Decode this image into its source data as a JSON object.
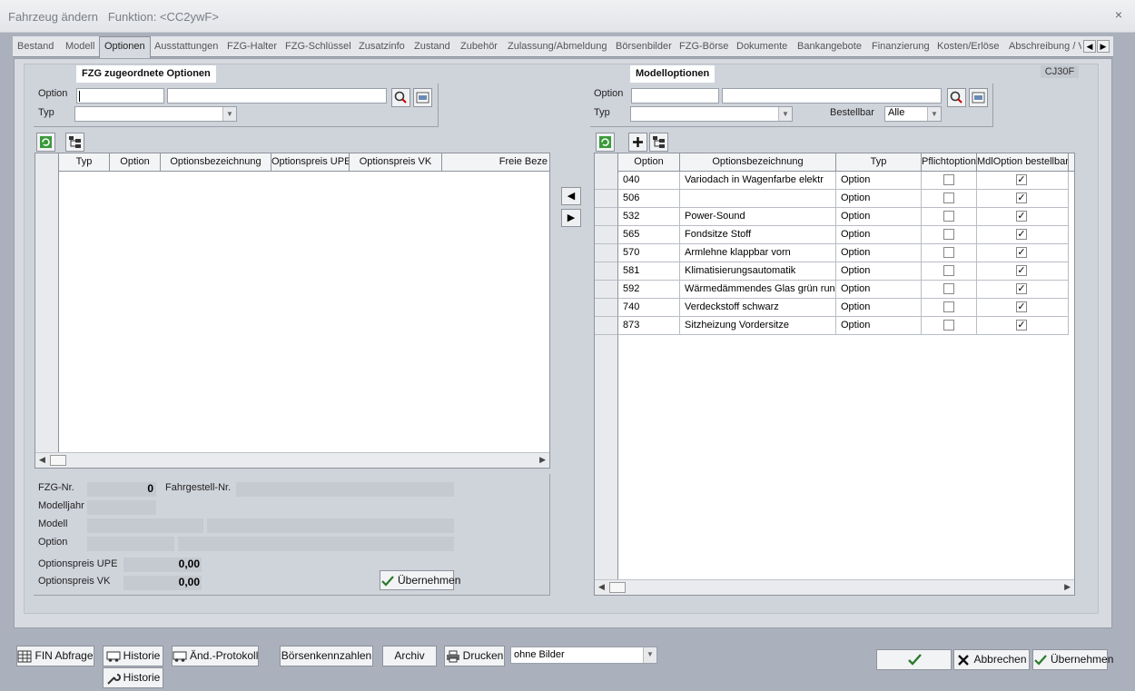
{
  "window": {
    "title": "Fahrzeug ändern   Funktion: <CC2ywF>",
    "close_glyph": "×"
  },
  "tabs": [
    "Bestand",
    "Modell",
    "Optionen",
    "Ausstattungen",
    "FZG-Halter",
    "FZG-Schlüssel",
    "Zusatzinfo",
    "Zustand",
    "Zubehör",
    "Zulassung/Abmeldung",
    "Börsenbilder",
    "FZG-Börse",
    "Dokumente",
    "Bankangebote",
    "Finanzierung",
    "Kosten/Erlöse",
    "Abschreibung / V"
  ],
  "active_tab": "Optionen",
  "code_badge": "CJ30F",
  "left": {
    "title": "FZG zugeordnete Optionen",
    "option_label": "Option",
    "typ_label": "Typ",
    "option_value": "",
    "option_desc_value": "",
    "typ_value": "",
    "grid_columns": [
      "Typ",
      "Option",
      "Optionsbezeichnung",
      "Optionspreis UPE",
      "Optionspreis VK",
      "Freie Beze"
    ],
    "detail": {
      "fzg_nr_label": "FZG-Nr.",
      "fzg_nr_value": "0",
      "fahrgestell_label": "Fahrgestell-Nr.",
      "modelljahr_label": "Modelljahr",
      "modell_label": "Modell",
      "option_label": "Option",
      "upe_label": "Optionspreis UPE",
      "upe_value": "0,00",
      "vk_label": "Optionspreis VK",
      "vk_value": "0,00",
      "apply_button": "Übernehmen"
    }
  },
  "right": {
    "title": "Modelloptionen",
    "option_label": "Option",
    "typ_label": "Typ",
    "bestellbar_label": "Bestellbar",
    "bestellbar_value": "Alle",
    "grid_columns": [
      "Option",
      "Optionsbezeichnung",
      "Typ",
      "Pflichtoption",
      "MdlOption bestellbar"
    ],
    "rows": [
      {
        "option": "040",
        "desc": "Variodach in Wagenfarbe elektr",
        "typ": "Option",
        "pflicht": false,
        "bestellbar": true
      },
      {
        "option": "506",
        "desc": "",
        "typ": "Option",
        "pflicht": false,
        "bestellbar": true
      },
      {
        "option": "532",
        "desc": "Power-Sound",
        "typ": "Option",
        "pflicht": false,
        "bestellbar": true
      },
      {
        "option": "565",
        "desc": "Fondsitze Stoff",
        "typ": "Option",
        "pflicht": false,
        "bestellbar": true
      },
      {
        "option": "570",
        "desc": "Armlehne klappbar vorn",
        "typ": "Option",
        "pflicht": false,
        "bestellbar": true
      },
      {
        "option": "581",
        "desc": "Klimatisierungsautomatik",
        "typ": "Option",
        "pflicht": false,
        "bestellbar": true
      },
      {
        "option": "592",
        "desc": "Wärmedämmendes Glas grün run",
        "typ": "Option",
        "pflicht": false,
        "bestellbar": true
      },
      {
        "option": "740",
        "desc": "Verdeckstoff schwarz",
        "typ": "Option",
        "pflicht": false,
        "bestellbar": true
      },
      {
        "option": "873",
        "desc": "Sitzheizung Vordersitze",
        "typ": "Option",
        "pflicht": false,
        "bestellbar": true
      }
    ]
  },
  "bottom": {
    "fin_button": "FIN Abfrage",
    "historie_button": "Historie",
    "historie_sub_button": "Historie",
    "protokoll_button": "Änd.-Protokoll",
    "boersen_button": "Börsenkennzahlen",
    "archiv_button": "Archiv",
    "drucken_button": "Drucken",
    "bilder_value": "ohne Bilder",
    "abbrechen_button": "Abbrechen",
    "uebernehmen_button": "Übernehmen"
  }
}
